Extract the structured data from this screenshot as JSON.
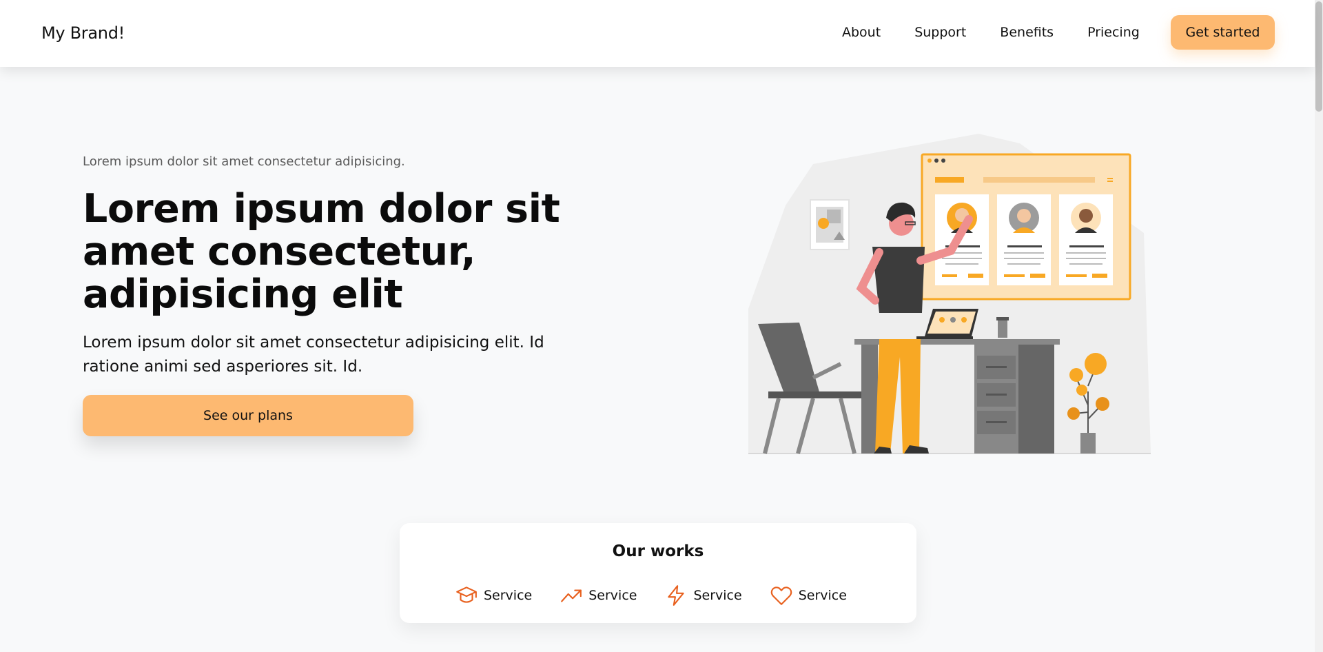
{
  "header": {
    "brand": "My Brand!",
    "nav": [
      "About",
      "Support",
      "Benefits",
      "Priecing"
    ],
    "cta": "Get started"
  },
  "hero": {
    "eyebrow": "Lorem ipsum dolor sit amet consectetur adipisicing.",
    "title": "Lorem ipsum dolor sit amet consectetur, adipisicing elit",
    "subtitle": "Lorem ipsum dolor sit amet consectetur adipisicing elit. Id ratione animi sed asperiores sit. Id.",
    "cta": "See our plans"
  },
  "works": {
    "title": "Our works",
    "services": [
      {
        "icon": "graduation-cap-icon",
        "label": "Service"
      },
      {
        "icon": "trending-up-icon",
        "label": "Service"
      },
      {
        "icon": "lightning-icon",
        "label": "Service"
      },
      {
        "icon": "heart-icon",
        "label": "Service"
      }
    ]
  },
  "colors": {
    "accent": "#fdb971",
    "icon": "#e8601e",
    "illustration_orange": "#f8a824"
  }
}
